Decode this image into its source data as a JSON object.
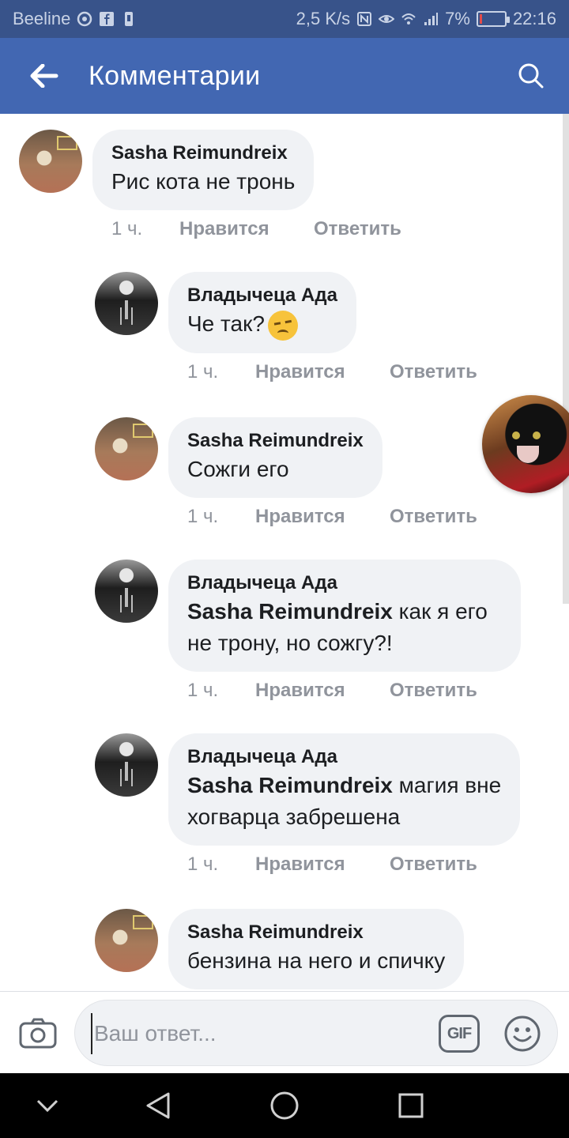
{
  "status_bar": {
    "carrier": "Beeline",
    "speed": "2,5 K/s",
    "battery": "7%",
    "time": "22:16",
    "battery_fraction": 0.07
  },
  "header": {
    "title": "Комментарии",
    "back_icon": "arrow-left-icon",
    "search_icon": "search-icon",
    "background": "#4267b2"
  },
  "comments": [
    {
      "author": "Sasha Reimundreix",
      "text": "Рис кота не тронь",
      "time": "1 ч.",
      "like": "Нравится",
      "reply": "Ответить"
    },
    {
      "author": "Владычеца Ада",
      "text": "Че так?",
      "time": "1 ч.",
      "like": "Нравится",
      "reply": "Ответить",
      "emoji": "disappointed-face"
    },
    {
      "author": "Sasha Reimundreix",
      "text": "Сожги его",
      "time": "1 ч.",
      "like": "Нравится",
      "reply": "Ответить"
    },
    {
      "author": "Владычеца Ада",
      "mention": "Sasha Reimundreix",
      "text": " как я его",
      "text2": "не трону, но сожгу?!",
      "time": "1 ч.",
      "like": "Нравится",
      "reply": "Ответить"
    },
    {
      "author": "Владычеца Ада",
      "mention": "Sasha Reimundreix",
      "text": " магия вне",
      "text2": "хогварца забрешена",
      "time": "1 ч.",
      "like": "Нравится",
      "reply": "Ответить"
    },
    {
      "author": "Sasha Reimundreix",
      "text": "бензина на него и спичку"
    }
  ],
  "composer": {
    "placeholder": "Ваш ответ...",
    "gif_label": "GIF",
    "camera_icon": "camera-icon",
    "emoji_icon": "smiley-icon"
  },
  "nav_bar": {
    "icons": [
      "chevron-down-icon",
      "back-triangle-icon",
      "home-circle-icon",
      "recents-square-icon"
    ]
  }
}
